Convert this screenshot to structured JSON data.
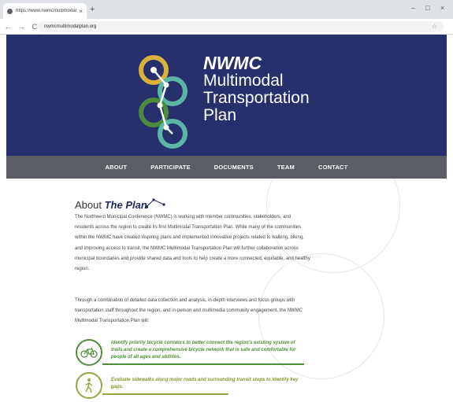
{
  "browser": {
    "tab_title": "https://www.nwmcmultimodalpl...",
    "tab_close": "×",
    "new_tab": "+",
    "back": "←",
    "forward": "→",
    "reload": "C",
    "url": "nwmcmultimodalplan.org",
    "bookmark": "☆",
    "minimize": "–",
    "maximize": "□",
    "close": "×"
  },
  "hero": {
    "abbr": "NWMC",
    "line1": "Multimodal",
    "line2": "Transportation",
    "line3": "Plan"
  },
  "nav": {
    "items": [
      "ABOUT",
      "PARTICIPATE",
      "DOCUMENTS",
      "TEAM",
      "CONTACT"
    ]
  },
  "about": {
    "heading_prefix": "About",
    "heading_emphasis": "The Plan",
    "paragraph1": "The Northwest Municipal Conference (NWMC) is working with member communities, stakeholders, and residents across the region to create its first Multimodal Transportation Plan. While many of the communities within the NWMC have created inspiring plans and implemented innovative projects related to walking, biking, and improving access to transit, the NWMC Multimodal Transportation Plan will further collaboration across municipal boundaries and provide shared data and tools to help create a more connected, equitable, and healthy region.",
    "paragraph2": "Through a combination of detailed data collection and analysis, in-depth interviews and focus groups with transportation staff throughout the region, and in-person and multimedia community engagement, the NWMC Multimodal Transportation Plan will:"
  },
  "goals": [
    {
      "icon": "bicycle-icon",
      "color": "#4f8f3a",
      "text": "Identify priority bicycle corridors to better connect the region's existing system of trails and create a comprehensive bicycle network that is safe and comfortable for people of all ages and abilities."
    },
    {
      "icon": "pedestrian-icon",
      "color": "#9aa441",
      "text": "Evaluate sidewalks along major roads and surrounding transit stops to identify key gaps."
    }
  ],
  "colors": {
    "hero_bg": "#27306c",
    "nav_bg": "#5a5d63",
    "logo_yellow": "#d9b13b",
    "logo_green": "#4c8a3f",
    "logo_teal": "#5cb6a7"
  }
}
